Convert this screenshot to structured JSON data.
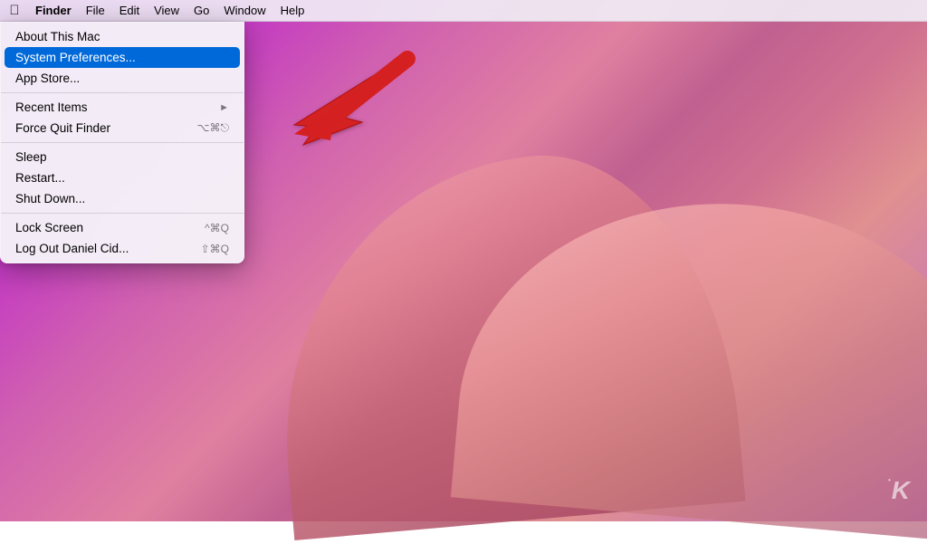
{
  "desktop": {
    "background_description": "macOS Big Sur purple gradient wallpaper"
  },
  "menubar": {
    "apple_label": "",
    "items": [
      {
        "id": "finder",
        "label": "Finder",
        "bold": true,
        "active": false
      },
      {
        "id": "file",
        "label": "File",
        "bold": false,
        "active": false
      },
      {
        "id": "edit",
        "label": "Edit",
        "bold": false,
        "active": false
      },
      {
        "id": "view",
        "label": "View",
        "bold": false,
        "active": false
      },
      {
        "id": "go",
        "label": "Go",
        "bold": false,
        "active": false
      },
      {
        "id": "window",
        "label": "Window",
        "bold": false,
        "active": false
      },
      {
        "id": "help",
        "label": "Help",
        "bold": false,
        "active": false
      }
    ]
  },
  "apple_menu": {
    "items": [
      {
        "id": "about-mac",
        "label": "About This Mac",
        "shortcut": "",
        "arrow": false,
        "separator_after": false
      },
      {
        "id": "system-prefs",
        "label": "System Preferences...",
        "shortcut": "",
        "arrow": false,
        "highlighted": true,
        "separator_after": false
      },
      {
        "id": "app-store",
        "label": "App Store...",
        "shortcut": "",
        "arrow": false,
        "separator_after": true
      },
      {
        "id": "recent-items",
        "label": "Recent Items",
        "shortcut": "",
        "arrow": true,
        "separator_after": false
      },
      {
        "id": "force-quit",
        "label": "Force Quit Finder",
        "shortcut": "⌥⌘⎋",
        "arrow": false,
        "separator_after": true
      },
      {
        "id": "sleep",
        "label": "Sleep",
        "shortcut": "",
        "arrow": false,
        "separator_after": false
      },
      {
        "id": "restart",
        "label": "Restart...",
        "shortcut": "",
        "arrow": false,
        "separator_after": false
      },
      {
        "id": "shut-down",
        "label": "Shut Down...",
        "shortcut": "",
        "arrow": false,
        "separator_after": true
      },
      {
        "id": "lock-screen",
        "label": "Lock Screen",
        "shortcut": "^⌘Q",
        "arrow": false,
        "separator_after": false
      },
      {
        "id": "log-out",
        "label": "Log Out Daniel Cid...",
        "shortcut": "⇧⌘Q",
        "arrow": false,
        "separator_after": false
      }
    ]
  },
  "watermark": {
    "text": "K",
    "dot": "•"
  },
  "colors": {
    "highlight_blue": "#0069d9",
    "menu_bg": "rgba(245,242,248,0.97)",
    "menubar_bg": "rgba(240,235,245,0.92)"
  }
}
